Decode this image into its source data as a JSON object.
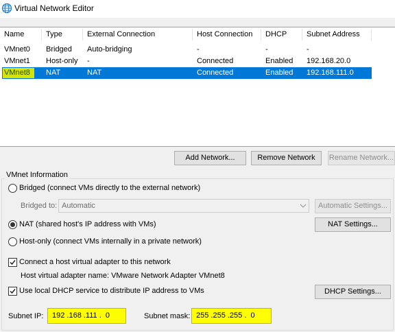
{
  "window": {
    "title": "Virtual Network Editor",
    "icon": "network-globe-icon"
  },
  "table": {
    "columns": [
      "Name",
      "Type",
      "External Connection",
      "Host Connection",
      "DHCP",
      "Subnet Address"
    ],
    "rows": [
      {
        "name": "VMnet0",
        "type": "Bridged",
        "external": "Auto-bridging",
        "host": "-",
        "dhcp": "-",
        "subnet": "-",
        "selected": false
      },
      {
        "name": "VMnet1",
        "type": "Host-only",
        "external": "-",
        "host": "Connected",
        "dhcp": "Enabled",
        "subnet": "192.168.20.0",
        "selected": false
      },
      {
        "name": "VMnet8",
        "type": "NAT",
        "external": "NAT",
        "host": "Connected",
        "dhcp": "Enabled",
        "subnet": "192.168.111.0",
        "selected": true
      }
    ]
  },
  "buttons": {
    "add_network": "Add Network...",
    "remove_network": "Remove Network",
    "rename_network": "Rename Network..."
  },
  "vmnet_info": {
    "group_label": "VMnet Information",
    "bridged_label": "Bridged (connect VMs directly to the external network)",
    "bridged_to_label": "Bridged to:",
    "bridged_to_value": "Automatic",
    "automatic_settings": "Automatic Settings...",
    "nat_label": "NAT (shared host's IP address with VMs)",
    "nat_settings": "NAT Settings...",
    "hostonly_label": "Host-only (connect VMs internally in a private network)",
    "selected_mode": "nat",
    "connect_adapter_label": "Connect a host virtual adapter to this network",
    "connect_adapter_checked": true,
    "adapter_name_label": "Host virtual adapter name: VMware Network Adapter VMnet8",
    "dhcp_label": "Use local DHCP service to distribute IP address to VMs",
    "dhcp_checked": true,
    "dhcp_settings": "DHCP Settings...",
    "subnet_ip_label": "Subnet IP:",
    "subnet_ip_value": "192 .168 .111 .  0",
    "subnet_mask_label": "Subnet mask:",
    "subnet_mask_value": "255 .255 .255 .  0"
  },
  "colors": {
    "selection": "#0078d7",
    "highlight": "#ffff00",
    "name_highlight": "#d6e400"
  }
}
